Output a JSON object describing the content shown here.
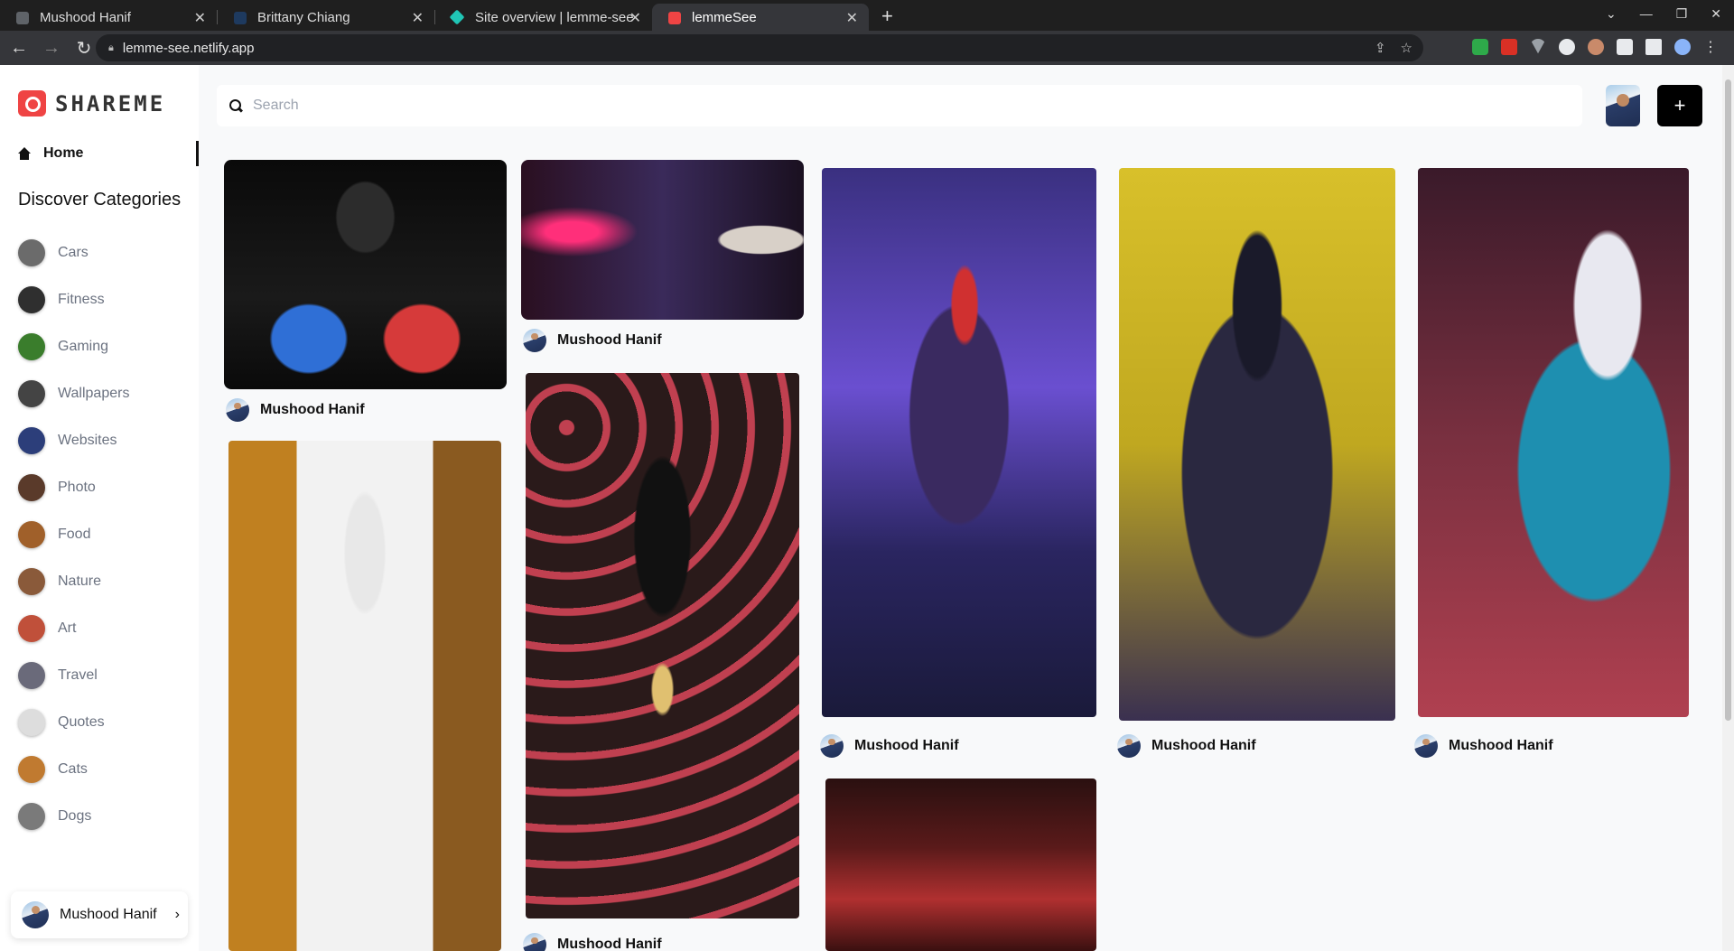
{
  "browser": {
    "tabs": [
      {
        "title": "Mushood Hanif",
        "favicon_color": "#5f6368"
      },
      {
        "title": "Brittany Chiang",
        "favicon_color": "#1e3a5f"
      },
      {
        "title": "Site overview | lemme-see",
        "favicon_color": "#20c6b6"
      },
      {
        "title": "lemmeSee",
        "favicon_color": "#ef4444"
      }
    ],
    "url": "lemme-see.netlify.app"
  },
  "app": {
    "brand": "SHAREME",
    "brand_color": "#ef4444",
    "home_label": "Home",
    "categories_heading": "Discover Categories",
    "categories": [
      {
        "label": "Cars",
        "thumb_color": "#6b6b6b"
      },
      {
        "label": "Fitness",
        "thumb_color": "#2f2f2f"
      },
      {
        "label": "Gaming",
        "thumb_color": "#3a7d2c"
      },
      {
        "label": "Wallpapers",
        "thumb_color": "#444444"
      },
      {
        "label": "Websites",
        "thumb_color": "#2c3e7a"
      },
      {
        "label": "Photo",
        "thumb_color": "#5a3a2a"
      },
      {
        "label": "Food",
        "thumb_color": "#a0602a"
      },
      {
        "label": "Nature",
        "thumb_color": "#8a5a3a"
      },
      {
        "label": "Art",
        "thumb_color": "#c0503a"
      },
      {
        "label": "Travel",
        "thumb_color": "#6a6a7a"
      },
      {
        "label": "Quotes",
        "thumb_color": "#dddddd"
      },
      {
        "label": "Cats",
        "thumb_color": "#c07a30"
      },
      {
        "label": "Dogs",
        "thumb_color": "#7a7a7a"
      }
    ],
    "current_user": "Mushood Hanif",
    "search_placeholder": "Search",
    "add_label": "+"
  },
  "pins": [
    {
      "author": "Mushood Hanif",
      "palette": [
        "#0a0a0a",
        "#2f6fd6",
        "#d63a3a"
      ]
    },
    {
      "author": "Mushood Hanif",
      "palette": [
        "#1a1020",
        "#ff2f7a",
        "#3a2a5a"
      ]
    },
    {
      "author": "Mushood Hanif",
      "palette": [
        "#2a2560",
        "#6a4fd0",
        "#1a1a3a"
      ]
    },
    {
      "author": "Mushood Hanif",
      "palette": [
        "#d8c02a",
        "#1a1a2a",
        "#3a3050"
      ]
    },
    {
      "author": "Mushood Hanif",
      "palette": [
        "#7a3040",
        "#1e8fb0",
        "#e8e8f0"
      ]
    },
    {
      "author": "",
      "palette": [
        "#c08020",
        "#f2f2f2",
        "#5a3a1a"
      ]
    },
    {
      "author": "Mushood Hanif",
      "palette": [
        "#2a1a1a",
        "#c04050",
        "#e0c070"
      ]
    },
    {
      "author": "",
      "palette": [
        "#5a1a1a",
        "#b03030",
        "#2a1010"
      ]
    }
  ]
}
